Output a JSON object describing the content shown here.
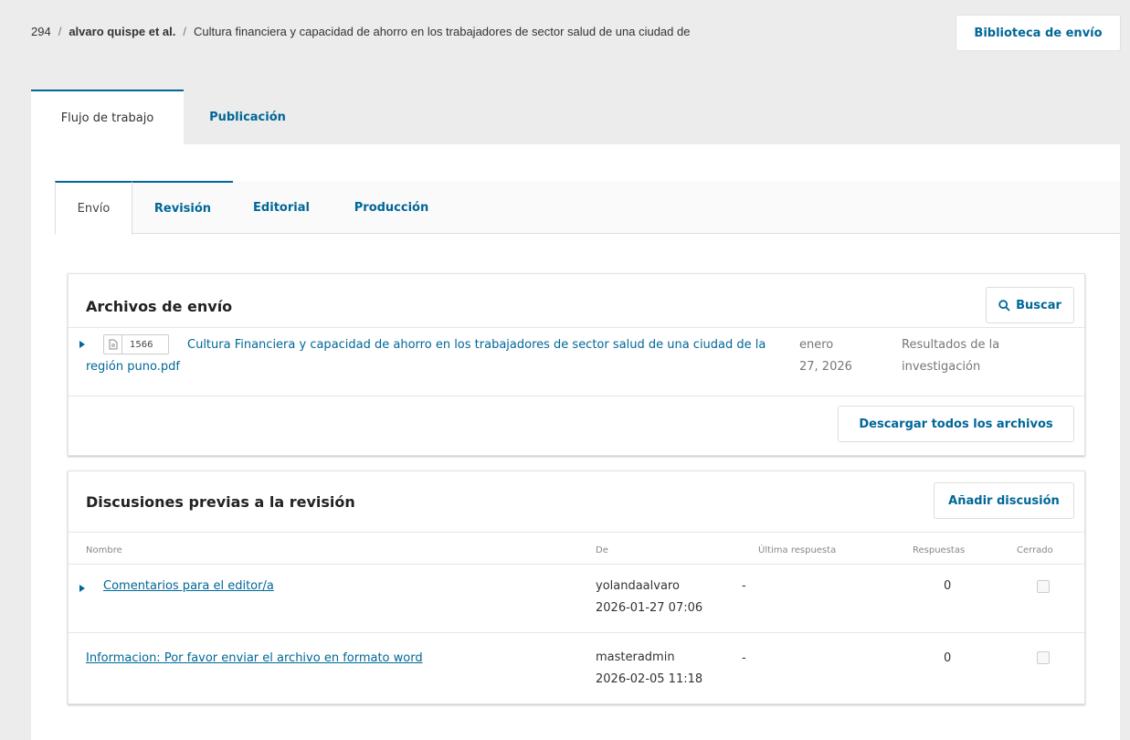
{
  "breadcrumb": {
    "id": "294",
    "author": "alvaro quispe et al.",
    "title": "Cultura financiera y capacidad de ahorro en los trabajadores de sector salud de una ciudad de",
    "separator": "/"
  },
  "header": {
    "library_button": "Biblioteca de envío"
  },
  "main_tabs": [
    {
      "label": "Flujo de trabajo",
      "active": true
    },
    {
      "label": "Publicación",
      "active": false
    }
  ],
  "sub_tabs": [
    {
      "label": "Envío",
      "active": true
    },
    {
      "label": "Revisión",
      "active": false
    },
    {
      "label": "Editorial",
      "active": false
    },
    {
      "label": "Producción",
      "active": false
    }
  ],
  "files": {
    "title": "Archivos de envío",
    "search_label": "Buscar",
    "items": [
      {
        "id": "1566",
        "name": "Cultura Financiera y capacidad de ahorro en los trabajadores de sector salud de una ciudad de la región puno.pdf",
        "date_line1": "enero",
        "date_line2": "27, 2026",
        "type_line1": "Resultados de la",
        "type_line2": "investigación"
      }
    ],
    "download_all_label": "Descargar todos los archivos"
  },
  "discussions": {
    "title": "Discusiones previas a la revisión",
    "add_label": "Añadir discusión",
    "columns": {
      "name": "Nombre",
      "from": "De",
      "last_reply": "Última respuesta",
      "replies": "Respuestas",
      "closed": "Cerrado"
    },
    "rows": [
      {
        "name": "Comentarios para el editor/a",
        "from_user": "yolandaalvaro",
        "from_date": "2026-01-27 07:06",
        "last_reply": "-",
        "replies": "0",
        "closed": false
      },
      {
        "name": "Informacion: Por favor enviar el archivo en formato word",
        "from_user": "masteradmin",
        "from_date": "2026-02-05 11:18",
        "last_reply": "-",
        "replies": "0",
        "closed": false
      }
    ]
  },
  "colors": {
    "accent": "#006798",
    "page_bg": "#ececec",
    "panel_bg": "#ffffff"
  }
}
